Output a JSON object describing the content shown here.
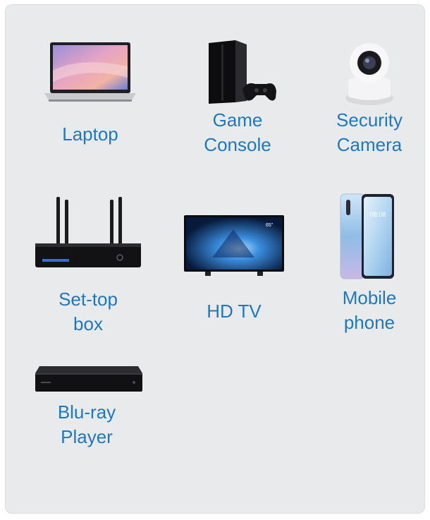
{
  "devices": [
    {
      "id": "laptop",
      "label": "Laptop",
      "icon": "laptop-icon"
    },
    {
      "id": "game_console",
      "label": "Game\nConsole",
      "icon": "game-console-icon"
    },
    {
      "id": "security_camera",
      "label": "Security\nCamera",
      "icon": "security-camera-icon"
    },
    {
      "id": "set_top_box",
      "label": "Set-top\nbox",
      "icon": "set-top-box-icon"
    },
    {
      "id": "hd_tv",
      "label": "HD TV",
      "icon": "tv-icon"
    },
    {
      "id": "mobile_phone",
      "label": "Mobile\nphone",
      "icon": "mobile-phone-icon"
    },
    {
      "id": "bluray_player",
      "label": "Blu-ray\nPlayer",
      "icon": "bluray-player-icon"
    }
  ],
  "tv_badge": "65\"",
  "phone_clock": "08:08",
  "colors": {
    "label": "#1f78be",
    "panel": "#e9eaec"
  }
}
